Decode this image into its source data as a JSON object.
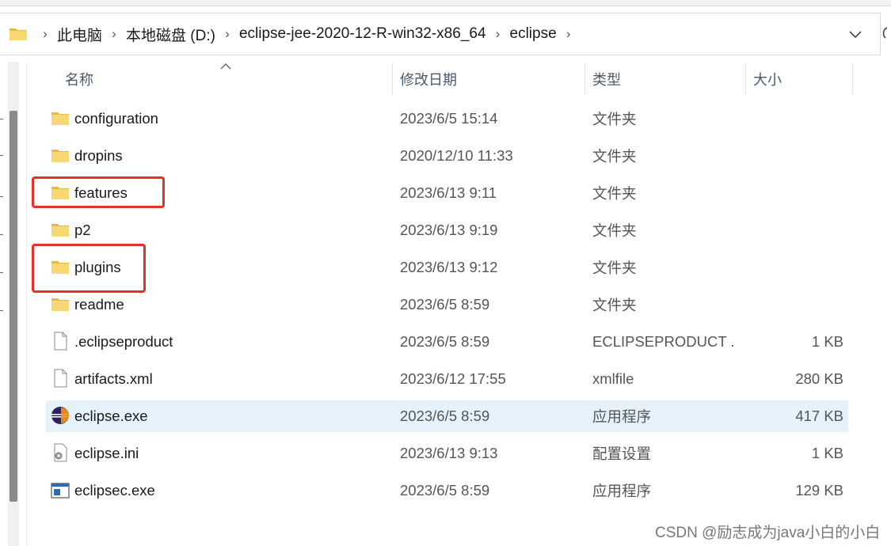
{
  "address_bar": {
    "breadcrumbs": [
      "此电脑",
      "本地磁盘 (D:)",
      "eclipse-jee-2020-12-R-win32-x86_64",
      "eclipse"
    ]
  },
  "columns": {
    "name": "名称",
    "date": "修改日期",
    "type": "类型",
    "size": "大小"
  },
  "files": [
    {
      "name": "configuration",
      "date": "2023/6/5 15:14",
      "type": "文件夹",
      "size": "",
      "icon": "folder-icon"
    },
    {
      "name": "dropins",
      "date": "2020/12/10 11:33",
      "type": "文件夹",
      "size": "",
      "icon": "folder-icon"
    },
    {
      "name": "features",
      "date": "2023/6/13 9:11",
      "type": "文件夹",
      "size": "",
      "icon": "folder-icon"
    },
    {
      "name": "p2",
      "date": "2023/6/13 9:19",
      "type": "文件夹",
      "size": "",
      "icon": "folder-icon"
    },
    {
      "name": "plugins",
      "date": "2023/6/13 9:12",
      "type": "文件夹",
      "size": "",
      "icon": "folder-icon"
    },
    {
      "name": "readme",
      "date": "2023/6/5 8:59",
      "type": "文件夹",
      "size": "",
      "icon": "folder-icon"
    },
    {
      "name": ".eclipseproduct",
      "date": "2023/6/5 8:59",
      "type": "ECLIPSEPRODUCT ...",
      "size": "1 KB",
      "icon": "file-icon"
    },
    {
      "name": "artifacts.xml",
      "date": "2023/6/12 17:55",
      "type": "xmlfile",
      "size": "280 KB",
      "icon": "file-icon"
    },
    {
      "name": "eclipse.exe",
      "date": "2023/6/5 8:59",
      "type": "应用程序",
      "size": "417 KB",
      "icon": "eclipse-app-icon"
    },
    {
      "name": "eclipse.ini",
      "date": "2023/6/13 9:13",
      "type": "配置设置",
      "size": "1 KB",
      "icon": "settings-file-icon"
    },
    {
      "name": "eclipsec.exe",
      "date": "2023/6/5 8:59",
      "type": "应用程序",
      "size": "129 KB",
      "icon": "console-app-icon"
    }
  ],
  "selected_row": "eclipse.exe",
  "highlighted_rows": [
    "features",
    "plugins"
  ],
  "colors": {
    "highlight_border": "#e0342a",
    "selected_row_bg": "#e5f1fb",
    "folder_yellow": "#f8d775"
  },
  "watermark": "CSDN @励志成为java小白的小白"
}
